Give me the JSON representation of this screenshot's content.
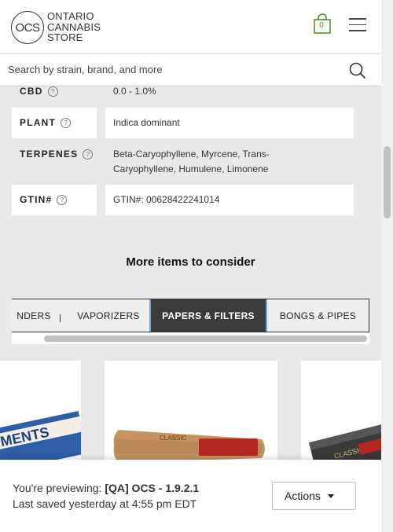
{
  "header": {
    "logo_abbr": "OCS",
    "logo_lines": [
      "ONTARIO",
      "CANNABIS",
      "STORE"
    ],
    "cart_count": "0"
  },
  "search": {
    "placeholder": "Search by strain, brand, and more"
  },
  "attributes": [
    {
      "label": "CBD",
      "value": "0.0 - 1.0%"
    },
    {
      "label": "PLANT",
      "value": "Indica dominant"
    },
    {
      "label": "TERPENES",
      "value_lines": [
        "Beta-Caryophyllene, Myrcene, Trans-",
        "Caryophyllene, Humulene, Limonene"
      ]
    },
    {
      "label": "GTIN#",
      "value": "GTIN#: 00628422241014"
    }
  ],
  "help_glyph": "?",
  "more_items": {
    "title": "More items to consider",
    "tabs": [
      {
        "label": "NDERS",
        "active": false
      },
      {
        "label": "VAPORIZERS",
        "active": false
      },
      {
        "label": "PAPERS & FILTERS",
        "active": true
      },
      {
        "label": "BONGS & PIPES",
        "active": false
      }
    ]
  },
  "products": [
    {
      "image": "rolling-papers-box-image",
      "text": "MENTS"
    },
    {
      "image": "raw-classic-cone-image",
      "text": "CLASSIC"
    },
    {
      "image": "raw-classic-papers-image",
      "text": "CLASSIC"
    }
  ],
  "preview": {
    "prefix": "You're previewing: ",
    "name": "[QA] OCS - 1.9.2.1",
    "saved": "Last saved yesterday at 4:55 pm EDT",
    "actions_label": "Actions"
  },
  "colors": {
    "cart_green": "#4a8c1c",
    "active_tab_bg": "#3b3b3b",
    "active_tab_border": "#6fa3d8",
    "page_bg": "#e9e9e9"
  }
}
